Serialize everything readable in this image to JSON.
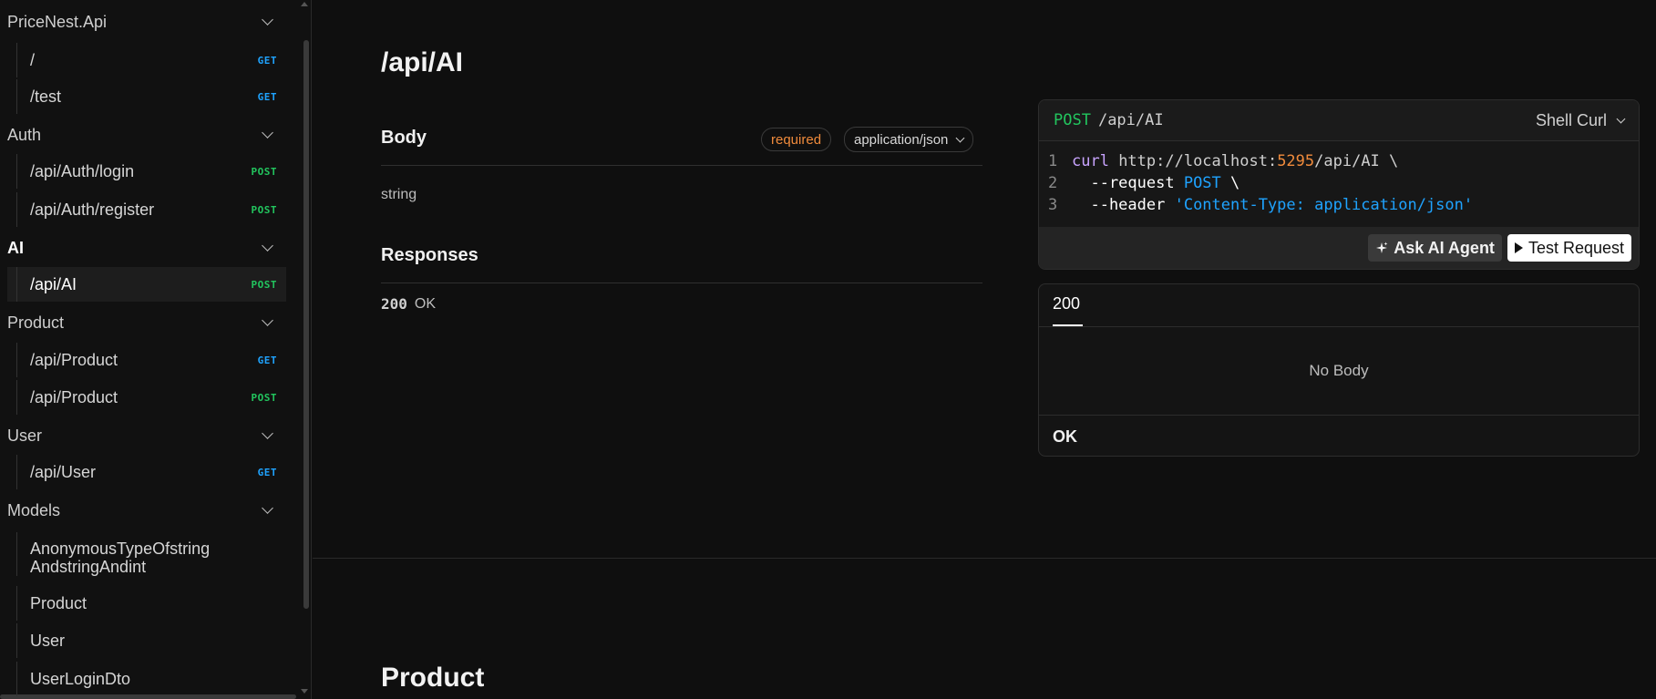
{
  "sidebar": {
    "groups": [
      {
        "label": "PriceNest.Api"
      },
      {
        "label": "Auth"
      },
      {
        "label": "AI"
      },
      {
        "label": "Product"
      },
      {
        "label": "User"
      },
      {
        "label": "Models"
      }
    ],
    "items": [
      {
        "label": "/",
        "method": "GET"
      },
      {
        "label": "/test",
        "method": "GET"
      },
      {
        "label": "/api/Auth/login",
        "method": "POST"
      },
      {
        "label": "/api/Auth/register",
        "method": "POST"
      },
      {
        "label": "/api/AI",
        "method": "POST"
      },
      {
        "label": "/api/Product",
        "method": "GET"
      },
      {
        "label": "/api/Product",
        "method": "POST"
      },
      {
        "label": "/api/User",
        "method": "GET"
      }
    ],
    "models": [
      {
        "label": "AnonymousTypeOfstring AndstringAndint"
      },
      {
        "label": "Product"
      },
      {
        "label": "User"
      },
      {
        "label": "UserLoginDto"
      }
    ]
  },
  "main": {
    "title": "/api/AI",
    "body": {
      "heading": "Body",
      "required": "required",
      "content_type": "application/json",
      "type": "string"
    },
    "responses": {
      "heading": "Responses",
      "code": "200",
      "text": "OK"
    },
    "next_section": "Product"
  },
  "code": {
    "method": "POST",
    "path": "/api/AI",
    "language": "Shell Curl",
    "lines": [
      {
        "n": "1",
        "cmd": "curl",
        "url": " http://localhost:",
        "port": "5295",
        "rest": "/api/AI \\"
      },
      {
        "n": "2",
        "flag": "  --request",
        "val": " POST",
        "rest": " \\"
      },
      {
        "n": "3",
        "flag": "  --header",
        "str": " 'Content-Type: application/json'"
      }
    ],
    "ask_ai_label": "Ask AI Agent",
    "test_label": "Test Request"
  },
  "response_panel": {
    "tab": "200",
    "no_body": "No Body",
    "status": "OK"
  },
  "colors": {
    "get": "#1fa3ff",
    "post": "#22c55e",
    "required": "#f08b3c",
    "port": "#f08b3c"
  }
}
